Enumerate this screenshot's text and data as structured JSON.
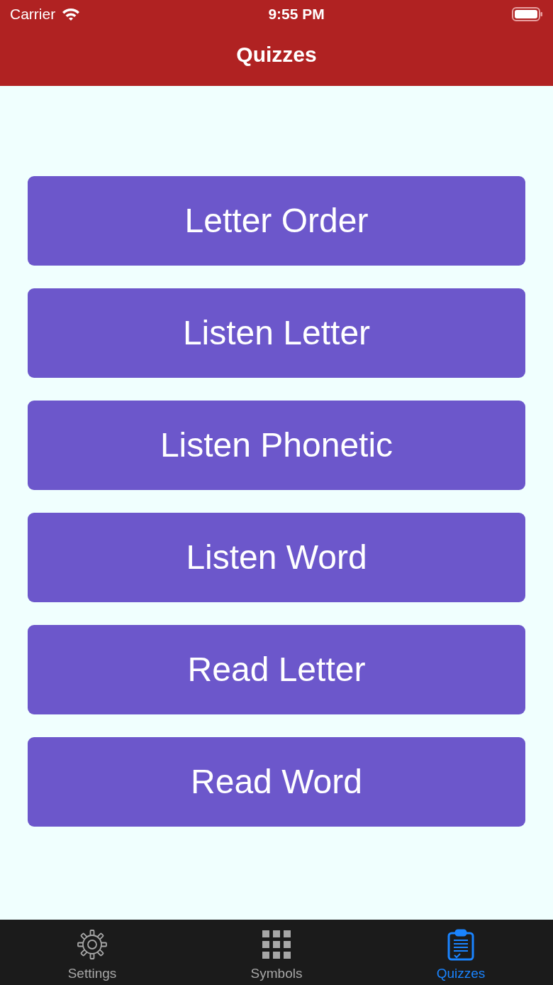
{
  "status_bar": {
    "carrier": "Carrier",
    "time": "9:55 PM"
  },
  "nav_bar": {
    "title": "Quizzes"
  },
  "quiz_buttons": [
    {
      "label": "Letter Order"
    },
    {
      "label": "Listen Letter"
    },
    {
      "label": "Listen Phonetic"
    },
    {
      "label": "Listen Word"
    },
    {
      "label": "Read Letter"
    },
    {
      "label": "Read Word"
    }
  ],
  "tab_bar": [
    {
      "label": "Settings",
      "kind": "gear",
      "selected": false
    },
    {
      "label": "Symbols",
      "kind": "grid",
      "selected": false
    },
    {
      "label": "Quizzes",
      "kind": "clipboard",
      "selected": true
    }
  ]
}
